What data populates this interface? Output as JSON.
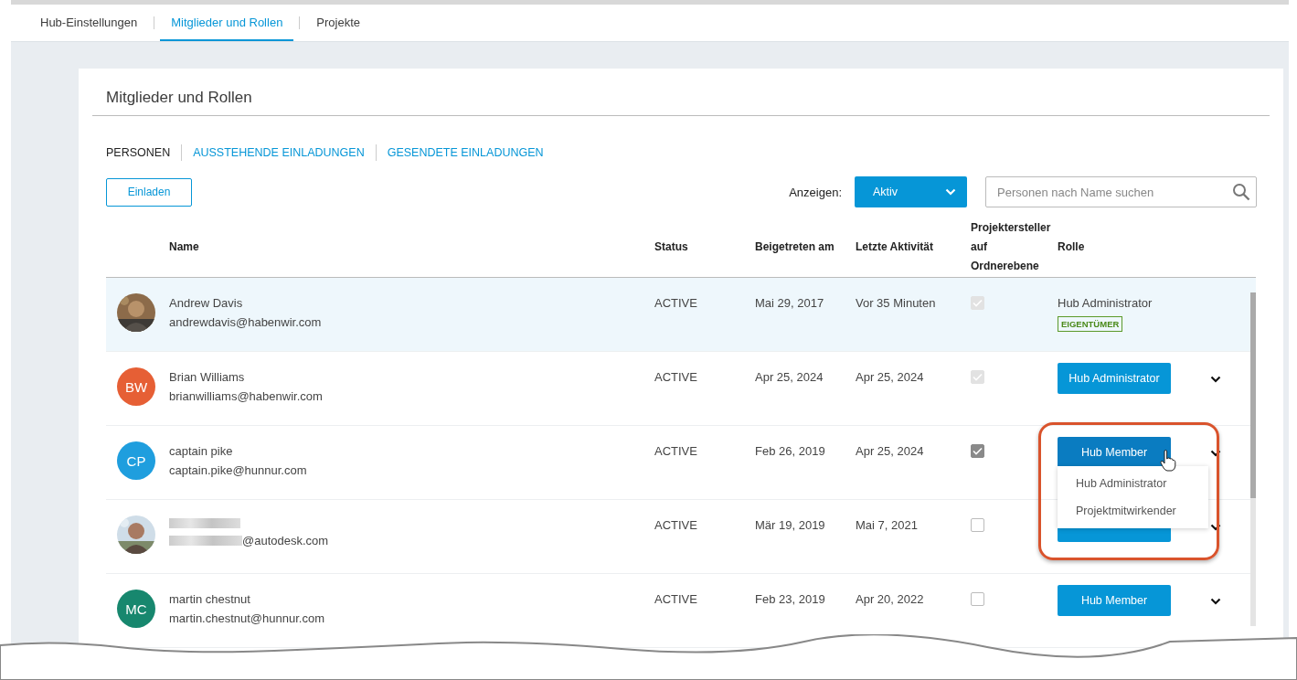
{
  "top_tabs": [
    {
      "label": "Hub-Einstellungen",
      "selected": false
    },
    {
      "label": "Mitglieder und Rollen",
      "selected": true
    },
    {
      "label": "Projekte",
      "selected": false
    }
  ],
  "card": {
    "title": "Mitglieder und Rollen",
    "sub_tabs": [
      {
        "label": "PERSONEN",
        "selected": true
      },
      {
        "label": "AUSSTEHENDE EINLADUNGEN",
        "selected": false
      },
      {
        "label": "GESENDETE EINLADUNGEN",
        "selected": false
      }
    ],
    "invite_button": "Einladen",
    "filter": {
      "label": "Anzeigen:",
      "value": "Aktiv"
    },
    "search": {
      "placeholder": "Personen nach Name suchen"
    },
    "table": {
      "columns": [
        "Name",
        "Status",
        "Beigetreten am",
        "Letzte Aktivität",
        "Projektersteller auf Ordnerebene",
        "Rolle"
      ],
      "rows": [
        {
          "name": "Andrew Davis",
          "email": "andrewdavis@habenwir.com",
          "status": "ACTIVE",
          "joined": "Mai 29, 2017",
          "last_activity": "Vor 35 Minuten",
          "checked": true,
          "disabled": true,
          "highlighted": true,
          "role": {
            "kind": "text",
            "label": "Hub Administrator",
            "badge": "EIGENTÜMER"
          }
        },
        {
          "avatar": {
            "kind": "initials",
            "initials": "BW",
            "color": "#e65f35"
          },
          "name": "Brian Williams",
          "email": "brianwilliams@habenwir.com",
          "status": "ACTIVE",
          "joined": "Apr 25, 2024",
          "last_activity": "Apr 25, 2024",
          "checked": true,
          "disabled": true,
          "highlighted": false,
          "role": {
            "kind": "button",
            "label": "Hub Administrator",
            "pressed": false
          }
        },
        {
          "avatar": {
            "kind": "initials",
            "initials": "CP",
            "color": "#1f9ede"
          },
          "name": "captain pike",
          "email": "captain.pike@hunnur.com",
          "status": "ACTIVE",
          "joined": "Feb 26, 2019",
          "last_activity": "Apr 25, 2024",
          "checked": true,
          "disabled": false,
          "highlighted": false,
          "role": {
            "kind": "button",
            "label": "Hub Member",
            "pressed": true,
            "menu": [
              "Hub Administrator",
              "Projektmitwirkender"
            ]
          }
        },
        {
          "name_redacted": true,
          "email": "@autodesk.com",
          "status": "ACTIVE",
          "joined": "Mär 19, 2019",
          "last_activity": "Mai 7, 2021",
          "checked": false,
          "disabled": false,
          "highlighted": false,
          "role": {
            "kind": "button",
            "pressed": false
          }
        },
        {
          "avatar": {
            "kind": "initials",
            "initials": "MC",
            "color": "#17876e"
          },
          "name": "martin chestnut",
          "email": "martin.chestnut@hunnur.com",
          "status": "ACTIVE",
          "joined": "Feb 23, 2019",
          "last_activity": "Apr 20, 2022",
          "checked": false,
          "disabled": false,
          "highlighted": false,
          "role": {
            "kind": "button",
            "label": "Hub Member",
            "pressed": false
          }
        }
      ]
    }
  }
}
